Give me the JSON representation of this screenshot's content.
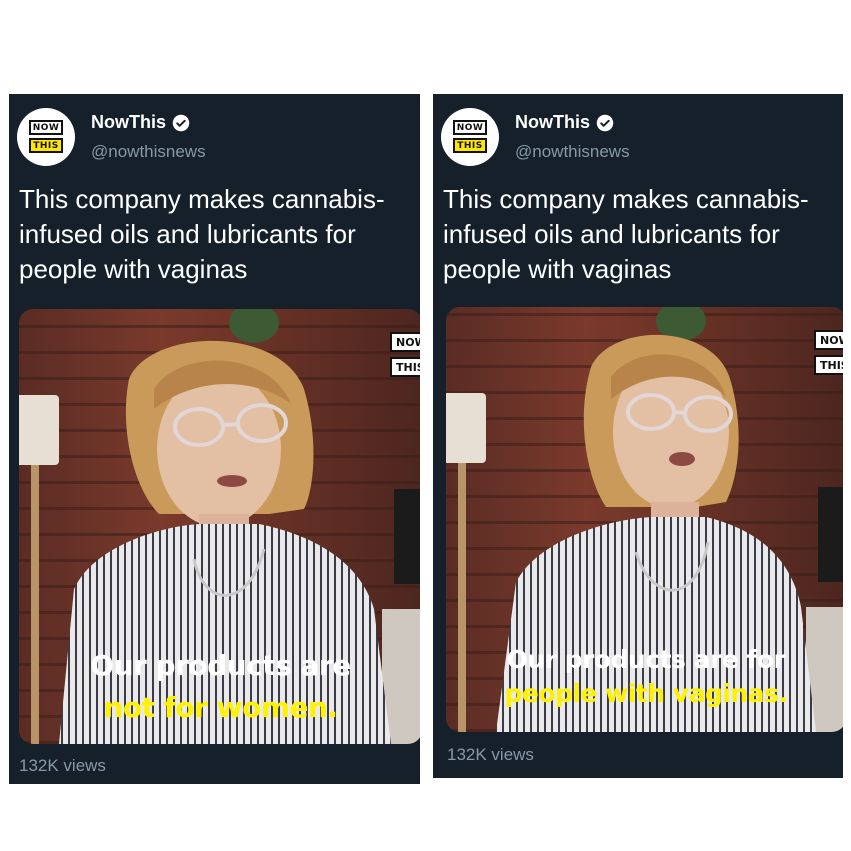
{
  "panels": [
    {
      "account_name": "NowThis",
      "handle": "@nowthisnews",
      "avatar_logo": {
        "top": "NOW",
        "bottom": "THIS"
      },
      "text": "This company makes cannabis-infused oils and lubricants for people with vaginas",
      "text_lines": [
        "This company makes cannabis-",
        "infused oils and lubricants for",
        "people with vaginas"
      ],
      "watermark": {
        "top": "NOW",
        "bottom": "THIS"
      },
      "caption_line1": "Our products are",
      "caption_line2": "not for women.",
      "views": "132K views",
      "verified_icon": "verified-badge-icon"
    },
    {
      "account_name": "NowThis",
      "handle": "@nowthisnews",
      "avatar_logo": {
        "top": "NOW",
        "bottom": "THIS"
      },
      "text": "This company makes cannabis-infused oils and lubricants for people with vaginas",
      "text_lines": [
        "This company makes cannabis-",
        "infused oils and lubricants for",
        "people with vaginas"
      ],
      "watermark": {
        "top": "NOW",
        "bottom": "THIS"
      },
      "caption_line1": "Our products are for",
      "caption_line2": "people with vaginas.",
      "views": "132K views",
      "verified_icon": "verified-badge-icon"
    }
  ],
  "colors": {
    "card_bg": "#15202b",
    "secondary_text": "#8899a6",
    "caption_white": "#ffffff",
    "caption_yellow": "#fff200",
    "logo_yellow": "#ffe500"
  }
}
